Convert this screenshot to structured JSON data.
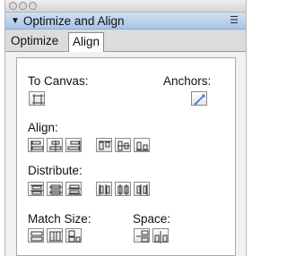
{
  "panel": {
    "title": "Optimize and Align"
  },
  "tabs": [
    {
      "label": "Optimize"
    },
    {
      "label": "Align"
    }
  ],
  "sections": {
    "to_canvas": "To Canvas:",
    "anchors": "Anchors:",
    "align": "Align:",
    "distribute": "Distribute:",
    "match_size": "Match Size:",
    "space": "Space:"
  },
  "icons": {
    "to_canvas": "fit-to-canvas-icon",
    "anchors": "anchor-wand-icon",
    "align": [
      "align-left-icon",
      "align-center-icon",
      "align-right-icon",
      "align-top-icon",
      "align-middle-icon",
      "align-bottom-icon"
    ],
    "distribute": [
      "distribute-top-icon",
      "distribute-vcenter-icon",
      "distribute-bottom-icon",
      "distribute-left-icon",
      "distribute-hcenter-icon",
      "distribute-right-icon"
    ],
    "match_size": [
      "match-width-icon",
      "match-height-icon",
      "match-both-icon"
    ],
    "space": [
      "space-vertical-icon",
      "space-horizontal-icon"
    ]
  },
  "colors": {
    "panel_header": "#b6cdeb",
    "active_anchor_arrow": "#3a6fd8"
  }
}
